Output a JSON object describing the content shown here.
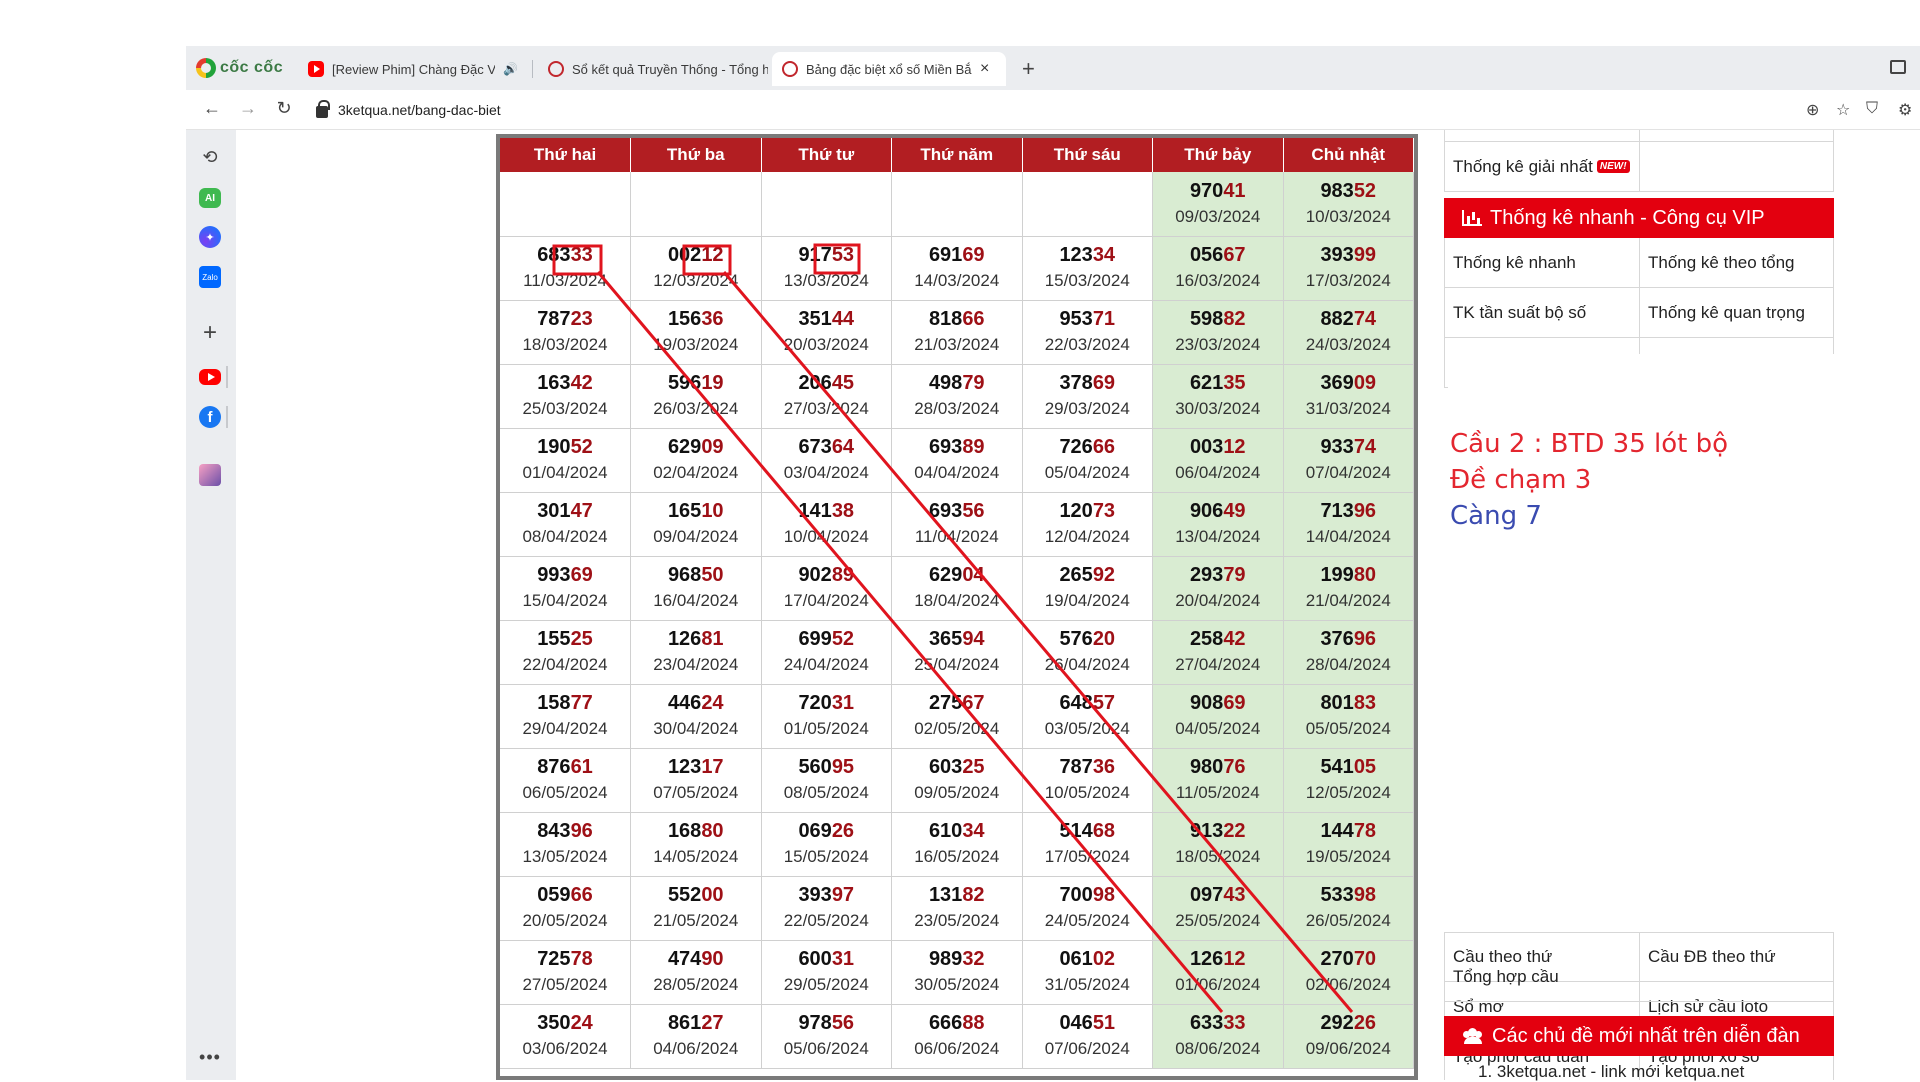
{
  "browser": {
    "brand": "cốc cốc",
    "tabs": [
      {
        "title": "[Review Phim] Chàng Đặc Vụ E"
      },
      {
        "title": "Sổ kết quả Truyền Thống - Tổng h"
      },
      {
        "title": "Bảng đặc biệt xổ số Miền Bắ",
        "active": true
      }
    ],
    "newtab_label": "+",
    "close_label": "×",
    "url": "3ketqua.net/bang-dac-biet"
  },
  "table": {
    "headers": [
      "Thứ hai",
      "Thứ ba",
      "Thứ tư",
      "Thứ năm",
      "Thứ sáu",
      "Thứ bảy",
      "Chủ nhật"
    ],
    "rows": [
      [
        null,
        null,
        null,
        null,
        null,
        {
          "h": "970",
          "t": "41",
          "d": "09/03/2024"
        },
        {
          "h": "983",
          "t": "52",
          "d": "10/03/2024"
        }
      ],
      [
        {
          "h": "683",
          "t": "33",
          "d": "11/03/2024"
        },
        {
          "h": "002",
          "t": "12",
          "d": "12/03/2024"
        },
        {
          "h": "917",
          "t": "53",
          "d": "13/03/2024"
        },
        {
          "h": "691",
          "t": "69",
          "d": "14/03/2024"
        },
        {
          "h": "123",
          "t": "34",
          "d": "15/03/2024"
        },
        {
          "h": "056",
          "t": "67",
          "d": "16/03/2024"
        },
        {
          "h": "393",
          "t": "99",
          "d": "17/03/2024"
        }
      ],
      [
        {
          "h": "787",
          "t": "23",
          "d": "18/03/2024"
        },
        {
          "h": "156",
          "t": "36",
          "d": "19/03/2024"
        },
        {
          "h": "351",
          "t": "44",
          "d": "20/03/2024"
        },
        {
          "h": "818",
          "t": "66",
          "d": "21/03/2024"
        },
        {
          "h": "953",
          "t": "71",
          "d": "22/03/2024"
        },
        {
          "h": "598",
          "t": "82",
          "d": "23/03/2024"
        },
        {
          "h": "882",
          "t": "74",
          "d": "24/03/2024"
        }
      ],
      [
        {
          "h": "163",
          "t": "42",
          "d": "25/03/2024"
        },
        {
          "h": "596",
          "t": "19",
          "d": "26/03/2024"
        },
        {
          "h": "206",
          "t": "45",
          "d": "27/03/2024"
        },
        {
          "h": "498",
          "t": "79",
          "d": "28/03/2024"
        },
        {
          "h": "378",
          "t": "69",
          "d": "29/03/2024"
        },
        {
          "h": "621",
          "t": "35",
          "d": "30/03/2024"
        },
        {
          "h": "369",
          "t": "09",
          "d": "31/03/2024"
        }
      ],
      [
        {
          "h": "190",
          "t": "52",
          "d": "01/04/2024"
        },
        {
          "h": "629",
          "t": "09",
          "d": "02/04/2024"
        },
        {
          "h": "673",
          "t": "64",
          "d": "03/04/2024"
        },
        {
          "h": "693",
          "t": "89",
          "d": "04/04/2024"
        },
        {
          "h": "726",
          "t": "66",
          "d": "05/04/2024"
        },
        {
          "h": "003",
          "t": "12",
          "d": "06/04/2024"
        },
        {
          "h": "933",
          "t": "74",
          "d": "07/04/2024"
        }
      ],
      [
        {
          "h": "301",
          "t": "47",
          "d": "08/04/2024"
        },
        {
          "h": "165",
          "t": "10",
          "d": "09/04/2024"
        },
        {
          "h": "141",
          "t": "38",
          "d": "10/04/2024"
        },
        {
          "h": "693",
          "t": "56",
          "d": "11/04/2024"
        },
        {
          "h": "120",
          "t": "73",
          "d": "12/04/2024"
        },
        {
          "h": "906",
          "t": "49",
          "d": "13/04/2024"
        },
        {
          "h": "713",
          "t": "96",
          "d": "14/04/2024"
        }
      ],
      [
        {
          "h": "993",
          "t": "69",
          "d": "15/04/2024"
        },
        {
          "h": "968",
          "t": "50",
          "d": "16/04/2024"
        },
        {
          "h": "902",
          "t": "89",
          "d": "17/04/2024"
        },
        {
          "h": "629",
          "t": "04",
          "d": "18/04/2024"
        },
        {
          "h": "265",
          "t": "92",
          "d": "19/04/2024"
        },
        {
          "h": "293",
          "t": "79",
          "d": "20/04/2024"
        },
        {
          "h": "199",
          "t": "80",
          "d": "21/04/2024"
        }
      ],
      [
        {
          "h": "155",
          "t": "25",
          "d": "22/04/2024"
        },
        {
          "h": "126",
          "t": "81",
          "d": "23/04/2024"
        },
        {
          "h": "699",
          "t": "52",
          "d": "24/04/2024"
        },
        {
          "h": "365",
          "t": "94",
          "d": "25/04/2024"
        },
        {
          "h": "576",
          "t": "20",
          "d": "26/04/2024"
        },
        {
          "h": "258",
          "t": "42",
          "d": "27/04/2024"
        },
        {
          "h": "376",
          "t": "96",
          "d": "28/04/2024"
        }
      ],
      [
        {
          "h": "158",
          "t": "77",
          "d": "29/04/2024"
        },
        {
          "h": "446",
          "t": "24",
          "d": "30/04/2024"
        },
        {
          "h": "720",
          "t": "31",
          "d": "01/05/2024"
        },
        {
          "h": "275",
          "t": "67",
          "d": "02/05/2024"
        },
        {
          "h": "648",
          "t": "57",
          "d": "03/05/2024"
        },
        {
          "h": "908",
          "t": "69",
          "d": "04/05/2024"
        },
        {
          "h": "801",
          "t": "83",
          "d": "05/05/2024"
        }
      ],
      [
        {
          "h": "876",
          "t": "61",
          "d": "06/05/2024"
        },
        {
          "h": "123",
          "t": "17",
          "d": "07/05/2024"
        },
        {
          "h": "560",
          "t": "95",
          "d": "08/05/2024"
        },
        {
          "h": "603",
          "t": "25",
          "d": "09/05/2024"
        },
        {
          "h": "787",
          "t": "36",
          "d": "10/05/2024"
        },
        {
          "h": "980",
          "t": "76",
          "d": "11/05/2024"
        },
        {
          "h": "541",
          "t": "05",
          "d": "12/05/2024"
        }
      ],
      [
        {
          "h": "843",
          "t": "96",
          "d": "13/05/2024"
        },
        {
          "h": "168",
          "t": "80",
          "d": "14/05/2024"
        },
        {
          "h": "069",
          "t": "26",
          "d": "15/05/2024"
        },
        {
          "h": "610",
          "t": "34",
          "d": "16/05/2024"
        },
        {
          "h": "514",
          "t": "68",
          "d": "17/05/2024"
        },
        {
          "h": "913",
          "t": "22",
          "d": "18/05/2024"
        },
        {
          "h": "144",
          "t": "78",
          "d": "19/05/2024"
        }
      ],
      [
        {
          "h": "059",
          "t": "66",
          "d": "20/05/2024"
        },
        {
          "h": "552",
          "t": "00",
          "d": "21/05/2024"
        },
        {
          "h": "393",
          "t": "97",
          "d": "22/05/2024"
        },
        {
          "h": "131",
          "t": "82",
          "d": "23/05/2024"
        },
        {
          "h": "700",
          "t": "98",
          "d": "24/05/2024"
        },
        {
          "h": "097",
          "t": "43",
          "d": "25/05/2024"
        },
        {
          "h": "533",
          "t": "98",
          "d": "26/05/2024"
        }
      ],
      [
        {
          "h": "725",
          "t": "78",
          "d": "27/05/2024"
        },
        {
          "h": "474",
          "t": "90",
          "d": "28/05/2024"
        },
        {
          "h": "600",
          "t": "31",
          "d": "29/05/2024"
        },
        {
          "h": "989",
          "t": "32",
          "d": "30/05/2024"
        },
        {
          "h": "061",
          "t": "02",
          "d": "31/05/2024"
        },
        {
          "h": "126",
          "t": "12",
          "d": "01/06/2024"
        },
        {
          "h": "270",
          "t": "70",
          "d": "02/06/2024"
        }
      ],
      [
        {
          "h": "350",
          "t": "24",
          "d": "03/06/2024"
        },
        {
          "h": "861",
          "t": "27",
          "d": "04/06/2024"
        },
        {
          "h": "978",
          "t": "56",
          "d": "05/06/2024"
        },
        {
          "h": "666",
          "t": "88",
          "d": "06/06/2024"
        },
        {
          "h": "046",
          "t": "51",
          "d": "07/06/2024"
        },
        {
          "h": "633",
          "t": "33",
          "d": "08/06/2024"
        },
        {
          "h": "292",
          "t": "26",
          "d": "09/06/2024"
        }
      ]
    ]
  },
  "right_panel": {
    "top_rows": [
      {
        "left": "Thống kê giải nhất",
        "left_badge": "NEW!",
        "right": ""
      }
    ],
    "vip_header": "Thống kê nhanh - Công cụ VIP",
    "vip_rows": [
      {
        "left": "Thống kê nhanh",
        "right": "Thống kê theo tổng"
      },
      {
        "left": "TK tần suất bộ số",
        "right": "Thống kê quan trọng"
      }
    ],
    "lower_rows": [
      {
        "left": "Cầu theo thứ",
        "right": "Cầu ĐB theo thứ"
      },
      {
        "left": "Sổ mơ",
        "right": "Lịch sử cầu loto"
      },
      {
        "left": "Tạo phôi cầu tuần",
        "right": "Tạo phôi xổ số"
      },
      {
        "left": "Tổng hợp cầu",
        "right": ""
      }
    ],
    "forum_header": "Các chủ đề mới nhất trên diễn đàn",
    "forum_first_item": "1. 3ketqua.net - link mới ketqua.net"
  },
  "annotation": {
    "lines": [
      {
        "text": "Cầu 2 : BTD 35 lót bộ",
        "color": "#e3262f"
      },
      {
        "text": "Đề chạm 3",
        "color": "#e3262f"
      },
      {
        "text": "Càng 7",
        "color": "#3a4bb0"
      }
    ]
  },
  "colors": {
    "header_red": "#b21e22",
    "tail_red": "#9e1016",
    "weekend_green": "#d9ecd2",
    "vip_red": "#e3000f",
    "marker_red": "#e0141e"
  }
}
